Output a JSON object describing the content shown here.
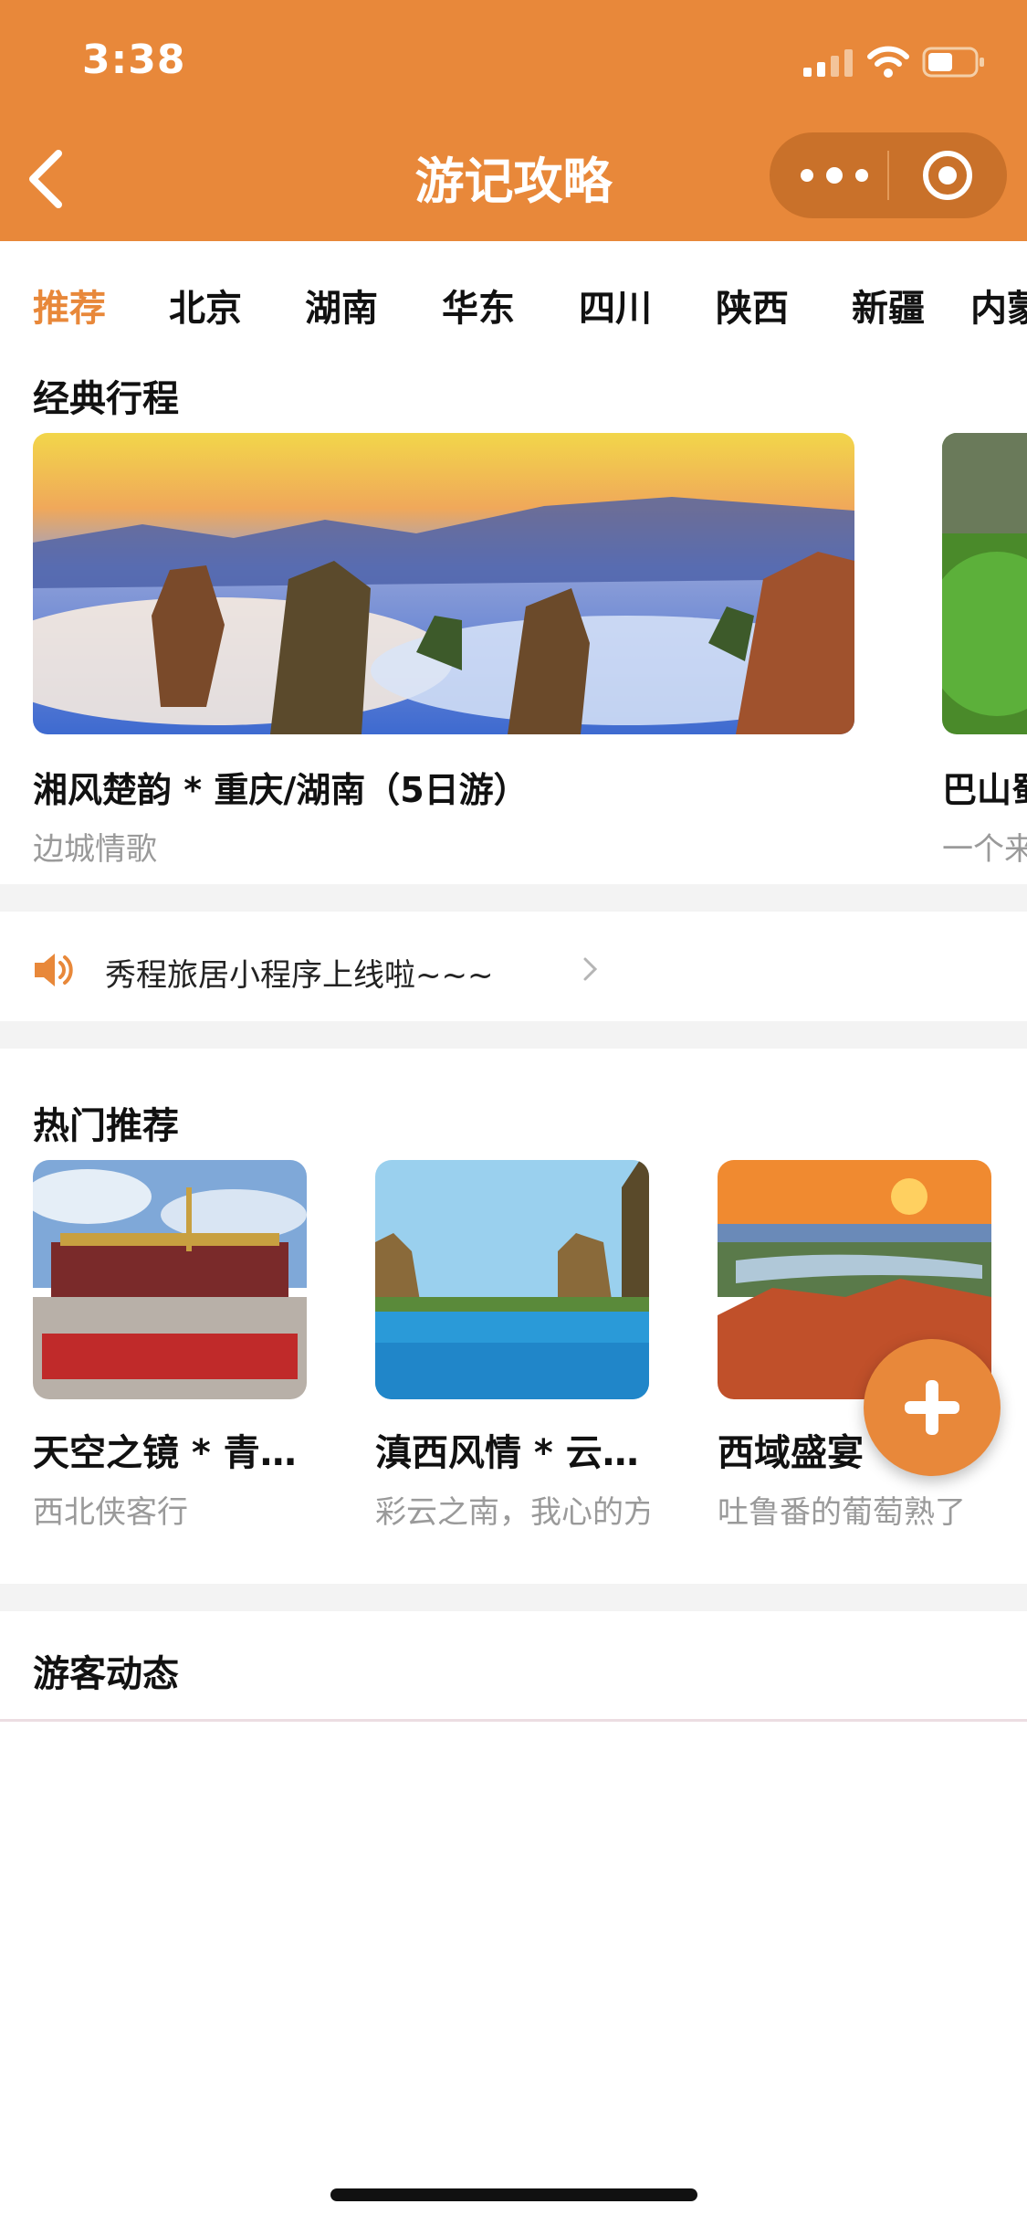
{
  "status_bar": {
    "time": "3:38"
  },
  "header": {
    "title": "游记攻略",
    "accent_color": "#e8883a"
  },
  "tabs": [
    {
      "label": "推荐",
      "active": true
    },
    {
      "label": "北京",
      "active": false
    },
    {
      "label": "湖南",
      "active": false
    },
    {
      "label": "华东",
      "active": false
    },
    {
      "label": "四川",
      "active": false
    },
    {
      "label": "陕西",
      "active": false
    },
    {
      "label": "新疆",
      "active": false
    },
    {
      "label": "内蒙",
      "active": false
    }
  ],
  "classic": {
    "title": "经典行程",
    "cards": [
      {
        "title": "湘风楚韵 * 重庆/湖南（5日游）",
        "subtitle": "边城情歌"
      },
      {
        "title": "巴山蜀",
        "subtitle": "一个来"
      }
    ]
  },
  "notice": {
    "text": "秀程旅居小程序上线啦~~~",
    "icon": "speaker-icon"
  },
  "hot": {
    "title": "热门推荐",
    "cards": [
      {
        "title": "天空之镜 * 青…",
        "subtitle": "西北侠客行"
      },
      {
        "title": "滇西风情 * 云…",
        "subtitle": "彩云之南，我心的方"
      },
      {
        "title": "西域盛宴",
        "subtitle": "吐鲁番的葡萄熟了"
      }
    ]
  },
  "travelers": {
    "title": "游客动态"
  }
}
